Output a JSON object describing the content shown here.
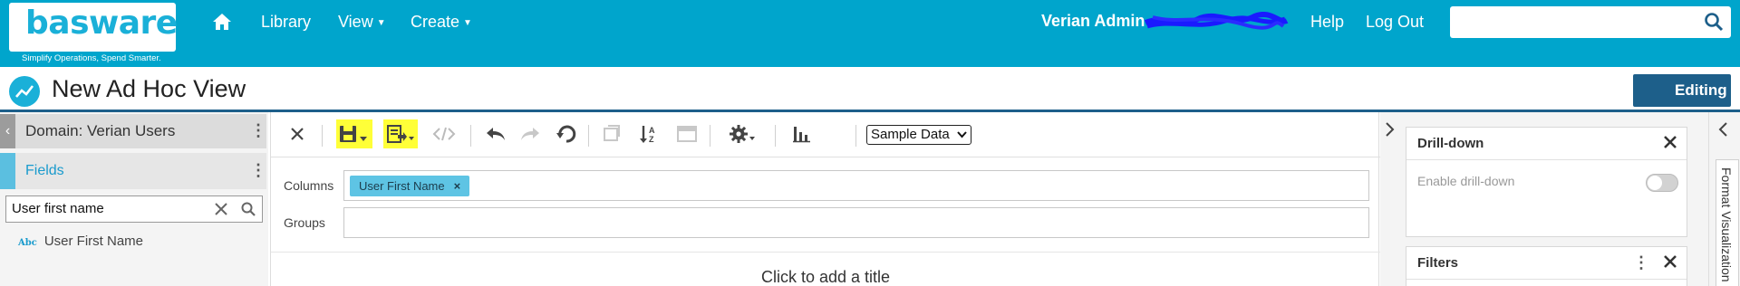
{
  "header": {
    "logo_text": "basware",
    "tagline": "Simplify Operations, Spend Smarter.",
    "nav": [
      {
        "label": "Library",
        "has_menu": false
      },
      {
        "label": "View",
        "has_menu": true
      },
      {
        "label": "Create",
        "has_menu": true
      }
    ],
    "user_label": "Verian Admin -",
    "help_label": "Help",
    "logout_label": "Log Out",
    "search_value": ""
  },
  "titlebar": {
    "title": "New Ad Hoc View",
    "mode_button": "Editing"
  },
  "left_panel": {
    "domain_label": "Domain: Verian Users",
    "fields_label": "Fields",
    "search_value": "User first name",
    "items": [
      {
        "type_badge": "Abc",
        "label": "User First Name"
      }
    ]
  },
  "toolbar": {
    "icons": [
      "close-icon",
      "save-icon",
      "export-icon",
      "code-icon",
      "undo-icon",
      "redo-icon",
      "undo-all-icon",
      "switch-group-icon",
      "sort-icon",
      "table-view-icon",
      "settings-icon",
      "chart-type-icon"
    ],
    "highlighted": [
      "save-icon",
      "export-icon"
    ],
    "data_select": {
      "selected": "Sample Data"
    }
  },
  "layout_rows": {
    "columns_label": "Columns",
    "groups_label": "Groups",
    "columns": [
      {
        "label": "User First Name",
        "remove": "×"
      }
    ],
    "groups": []
  },
  "canvas": {
    "title_placeholder": "Click to add a title"
  },
  "right_panel": {
    "drill": {
      "title": "Drill-down",
      "toggle_label": "Enable drill-down",
      "enabled": false
    },
    "filters": {
      "title": "Filters"
    },
    "vertical_tab": "Format Visualization"
  },
  "colors": {
    "header_bg": "#00a5cc",
    "brand_dark": "#1d5f8a",
    "accent": "#1a9bcd",
    "highlight": "#ffff38",
    "pill": "#5ec4e4",
    "scribble": "#1a1aff"
  }
}
